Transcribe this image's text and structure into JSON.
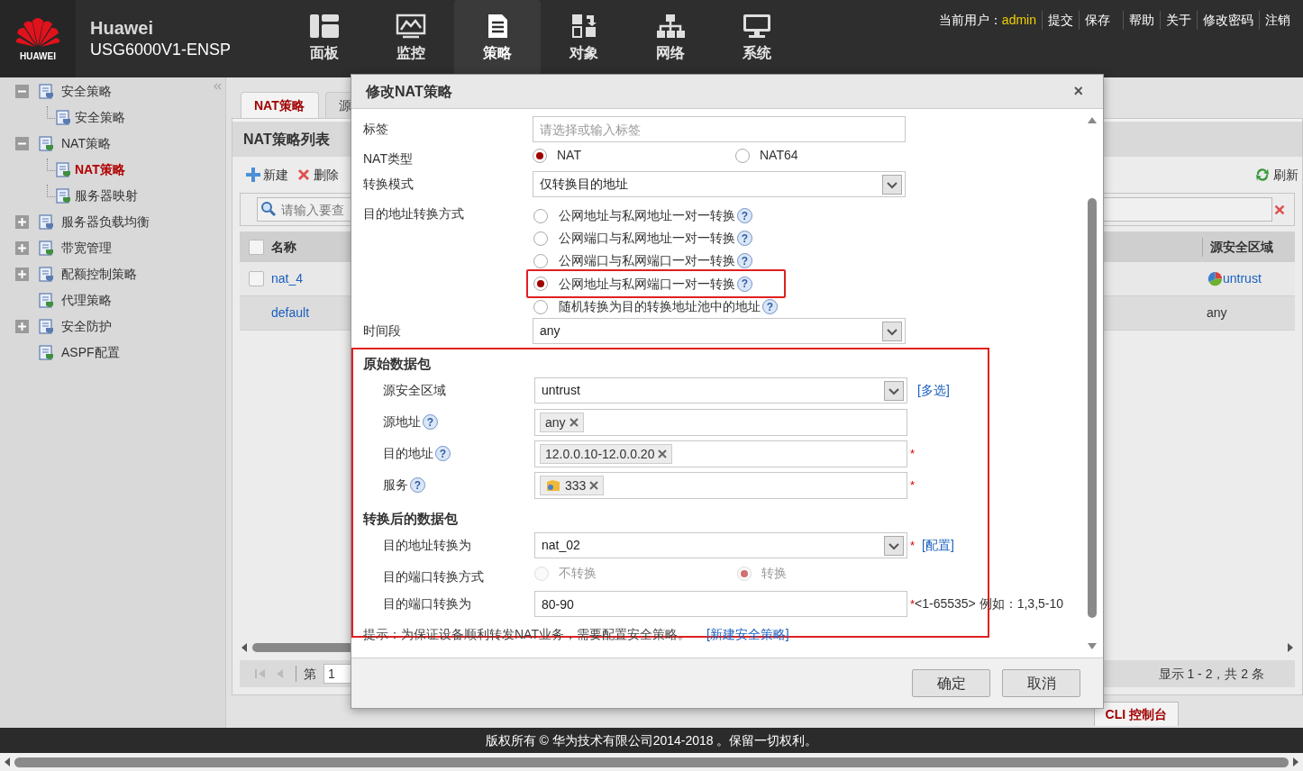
{
  "header": {
    "logo_text": "HUAWEI",
    "brand": "Huawei",
    "model": "USG6000V1-ENSP",
    "nav": [
      {
        "label": "面板",
        "selected": false
      },
      {
        "label": "监控",
        "selected": false
      },
      {
        "label": "策略",
        "selected": true
      },
      {
        "label": "对象",
        "selected": false
      },
      {
        "label": "网络",
        "selected": false
      },
      {
        "label": "系统",
        "selected": false
      }
    ],
    "user_label": "当前用户：",
    "user": "admin",
    "links": [
      "提交",
      "保存",
      "帮助",
      "关于",
      "修改密码",
      "注销"
    ]
  },
  "sidebar": {
    "items": [
      {
        "label": "安全策略",
        "expanded": true,
        "selected": false,
        "children": [
          {
            "label": "安全策略",
            "selected": false
          }
        ]
      },
      {
        "label": "NAT策略",
        "expanded": true,
        "selected": false,
        "children": [
          {
            "label": "NAT策略",
            "selected": true
          },
          {
            "label": "服务器映射",
            "selected": false
          }
        ]
      },
      {
        "label": "服务器负载均衡",
        "expanded": false,
        "selected": false
      },
      {
        "label": "带宽管理",
        "expanded": false,
        "selected": false
      },
      {
        "label": "配额控制策略",
        "expanded": false,
        "selected": false
      },
      {
        "label": "代理策略",
        "selected": false
      },
      {
        "label": "安全防护",
        "expanded": false,
        "selected": false
      },
      {
        "label": "ASPF配置",
        "selected": false
      }
    ]
  },
  "main": {
    "tabs": [
      {
        "label": "NAT策略",
        "selected": true
      },
      {
        "label": "源",
        "selected": false
      }
    ],
    "panel_title": "NAT策略列表",
    "toolbar": [
      {
        "kind": "add",
        "label": "新建"
      },
      {
        "kind": "delete",
        "label": "删除"
      }
    ],
    "refresh": "刷新",
    "search": {
      "placeholder": "请输入要查"
    },
    "table": {
      "header_checked": false,
      "columns": [
        "名称",
        "源安全区域"
      ],
      "rows": [
        {
          "kind": "policy",
          "checked": false,
          "name": "nat_4",
          "zone": "untrust"
        },
        {
          "kind": "default",
          "name": "default",
          "zone": "any"
        }
      ]
    },
    "pager": {
      "page_label": "第",
      "page": "1",
      "summary": "显示 1 - 2，共 2 条"
    },
    "cli_tab": "CLI 控制台"
  },
  "dialog": {
    "title": "修改NAT策略",
    "close": "×",
    "fields": [
      {
        "kind": "text",
        "label": "标签",
        "placeholder": "请选择或输入标签"
      },
      {
        "kind": "radio",
        "label": "NAT类型",
        "options": [
          {
            "label": "NAT",
            "selected": true
          },
          {
            "label": "NAT64",
            "selected": false
          }
        ]
      },
      {
        "kind": "select",
        "label": "转换模式",
        "value": "仅转换目的地址"
      },
      {
        "kind": "radio_list",
        "label": "目的地址转换方式",
        "options": [
          {
            "label": "公网地址与私网地址一对一转换",
            "help": "?",
            "selected": false,
            "highlighted": false
          },
          {
            "label": "公网端口与私网地址一对一转换",
            "help": "?",
            "selected": false,
            "highlighted": false
          },
          {
            "label": "公网端口与私网端口一对一转换",
            "help": "?",
            "selected": false,
            "highlighted": false
          },
          {
            "label": "公网地址与私网端口一对一转换",
            "help": "?",
            "selected": true,
            "highlighted": true
          },
          {
            "label": "随机转换为目的转换地址池中的地址",
            "help": "?",
            "selected": false,
            "highlighted": false
          }
        ]
      },
      {
        "kind": "select",
        "label": "时间段",
        "value": "any"
      },
      {
        "kind": "group",
        "highlighted": true,
        "children": [
          {
            "kind": "section",
            "label": "原始数据包",
            "children": [
              {
                "kind": "select",
                "label": "源安全区域",
                "value": "untrust",
                "link": "[多选]"
              },
              {
                "kind": "tags",
                "label": "源地址",
                "help": "?",
                "tags": [
                  {
                    "kind": "plain",
                    "text": "any"
                  }
                ]
              },
              {
                "kind": "tags",
                "label": "目的地址",
                "help": "?",
                "required_mark": "*",
                "tags": [
                  {
                    "kind": "plain",
                    "text": "12.0.0.10-12.0.0.20"
                  }
                ]
              },
              {
                "kind": "tags",
                "label": "服务",
                "help": "?",
                "required_mark": "*",
                "tags": [
                  {
                    "kind": "service",
                    "text": "333"
                  }
                ]
              }
            ]
          },
          {
            "kind": "section",
            "label": "转换后的数据包",
            "children": [
              {
                "kind": "select",
                "label": "目的地址转换为",
                "value": "nat_02",
                "required_mark": "*",
                "link": "[配置]"
              },
              {
                "kind": "radio",
                "label": "目的端口转换方式",
                "disabled": true,
                "options": [
                  {
                    "label": "不转换",
                    "selected": false
                  },
                  {
                    "label": "转换",
                    "selected": true
                  }
                ]
              },
              {
                "kind": "text",
                "label": "目的端口转换为",
                "value": "80-90",
                "required_mark": "*",
                "hint": "<1-65535> 例如：1,3,5-10"
              }
            ]
          },
          {
            "kind": "note",
            "text": "提示：为保证设备顺利转发NAT业务，需要配置安全策略。",
            "link": "[新建安全策略]"
          }
        ]
      }
    ],
    "buttons": [
      "确定",
      "取消"
    ]
  },
  "footer": {
    "copyright": "版权所有 © 华为技术有限公司2014-2018 。保留一切权利。"
  }
}
